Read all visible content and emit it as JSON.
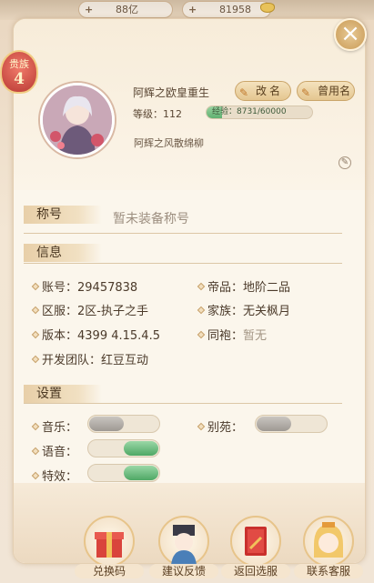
{
  "currency": {
    "amount1": "88亿",
    "amount2": "81958"
  },
  "profile": {
    "rank_title": "贵族",
    "rank_level": "4",
    "name": "阿辉之欧皇重生",
    "rename_label": "改名",
    "used_names_label": "曾用名",
    "level_label": "等级：112",
    "exp_text": "经验：8731/60000",
    "exp_ratio": 0.1455,
    "signature": "阿辉之风散绵柳"
  },
  "title_section": {
    "heading": "称号",
    "value": "暂未装备称号"
  },
  "info_section": {
    "heading": "信息",
    "account": "账号：29457838",
    "server": "区服：2区-执子之手",
    "version": "版本：4399 4.15.4.5",
    "dev_team": "开发团队：红豆互动",
    "grade_label": "帝品：",
    "grade_value": "地阶二品",
    "family_label": "家族：",
    "family_value": "无关枫月",
    "robe_label": "同袍：",
    "robe_value": "暂无"
  },
  "settings_section": {
    "heading": "设置",
    "music_label": "音乐：",
    "music_on": false,
    "villa_label": "别苑：",
    "villa_on": false,
    "voice_label": "语音：",
    "voice_on": true,
    "effects_label": "特效：",
    "effects_on": true
  },
  "bottom_buttons": {
    "redeem": "兑换码",
    "feedback": "建议反馈",
    "back_server": "返回选服",
    "contact": "联系客服"
  },
  "colors": {
    "accent": "#c99a55",
    "toggle_on": "#4fa865",
    "toggle_off": "#9e9993"
  }
}
